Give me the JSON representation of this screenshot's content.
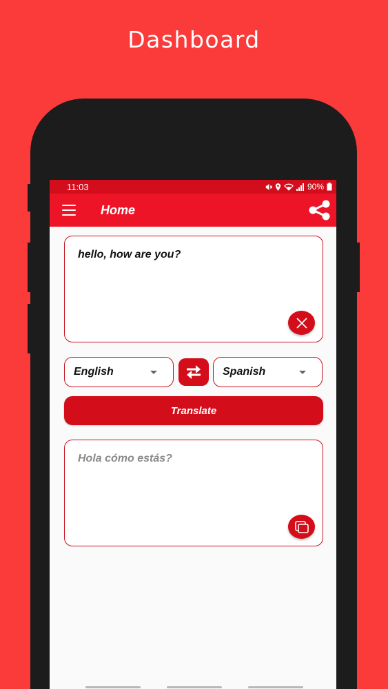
{
  "promo": {
    "title": "Dashboard"
  },
  "status_bar": {
    "time": "11:03",
    "battery": "90%"
  },
  "app_bar": {
    "title": "Home",
    "menu_icon": "hamburger-menu-icon",
    "share_icon": "share-icon"
  },
  "input_card": {
    "text": "hello, how are you?",
    "clear_icon": "close-icon"
  },
  "languages": {
    "source": "English",
    "target": "Spanish",
    "swap_icon": "swap-arrows-icon"
  },
  "translate_button": {
    "label": "Translate"
  },
  "output_card": {
    "text": "Hola cómo estás?",
    "copy_icon": "copy-icon"
  },
  "colors": {
    "background": "#fb3a3a",
    "primary": "#ee1428",
    "accent": "#d30d1a",
    "border": "#c8101c"
  }
}
